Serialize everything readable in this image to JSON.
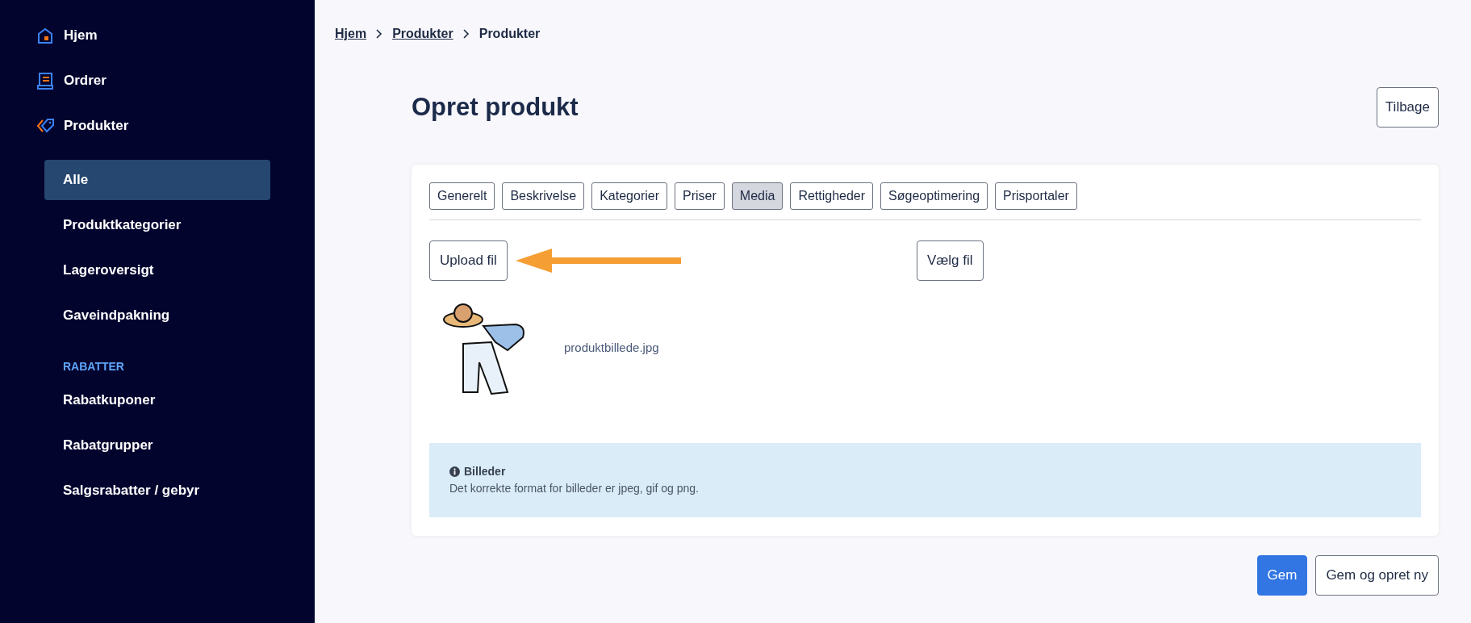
{
  "sidebar": {
    "items": [
      {
        "label": "Hjem",
        "kind": "home",
        "selected": false
      },
      {
        "label": "Ordrer",
        "kind": "orders",
        "selected": false
      },
      {
        "label": "Produkter",
        "kind": "tag",
        "selected": false,
        "children": [
          {
            "label": "Alle",
            "selected": true
          },
          {
            "label": "Produktkategorier",
            "selected": false
          },
          {
            "label": "Lageroversigt",
            "selected": false
          },
          {
            "label": "Gaveindpakning",
            "selected": false
          }
        ]
      }
    ],
    "sections": [
      {
        "heading": "RABATTER",
        "items": [
          {
            "label": "Rabatkuponer",
            "selected": false
          },
          {
            "label": "Rabatgrupper",
            "selected": false
          },
          {
            "label": "Salgsrabatter / gebyr",
            "selected": false
          }
        ]
      }
    ]
  },
  "breadcrumb": [
    {
      "label": "Hjem",
      "link": true
    },
    {
      "label": "Produkter",
      "link": true
    },
    {
      "label": "Produkter",
      "link": false
    }
  ],
  "title": "Opret produkt",
  "back_button": "Tilbage",
  "tabs": [
    {
      "label": "Generelt",
      "selected": false
    },
    {
      "label": "Beskrivelse",
      "selected": false
    },
    {
      "label": "Kategorier",
      "selected": false
    },
    {
      "label": "Priser",
      "selected": false
    },
    {
      "label": "Media",
      "selected": true
    },
    {
      "label": "Rettigheder",
      "selected": false
    },
    {
      "label": "Søgeoptimering",
      "selected": false
    },
    {
      "label": "Prisportaler",
      "selected": false
    }
  ],
  "upload_button": "Upload fil",
  "choose_button": "Vælg fil",
  "file": {
    "name": "produktbillede.jpg"
  },
  "info": {
    "title": "Billeder",
    "text": "Det korrekte format for billeder er jpeg, gif og png."
  },
  "actions": [
    {
      "label": "Gem",
      "kind": "primary"
    },
    {
      "label": "Gem og opret ny",
      "kind": "secondary"
    }
  ]
}
